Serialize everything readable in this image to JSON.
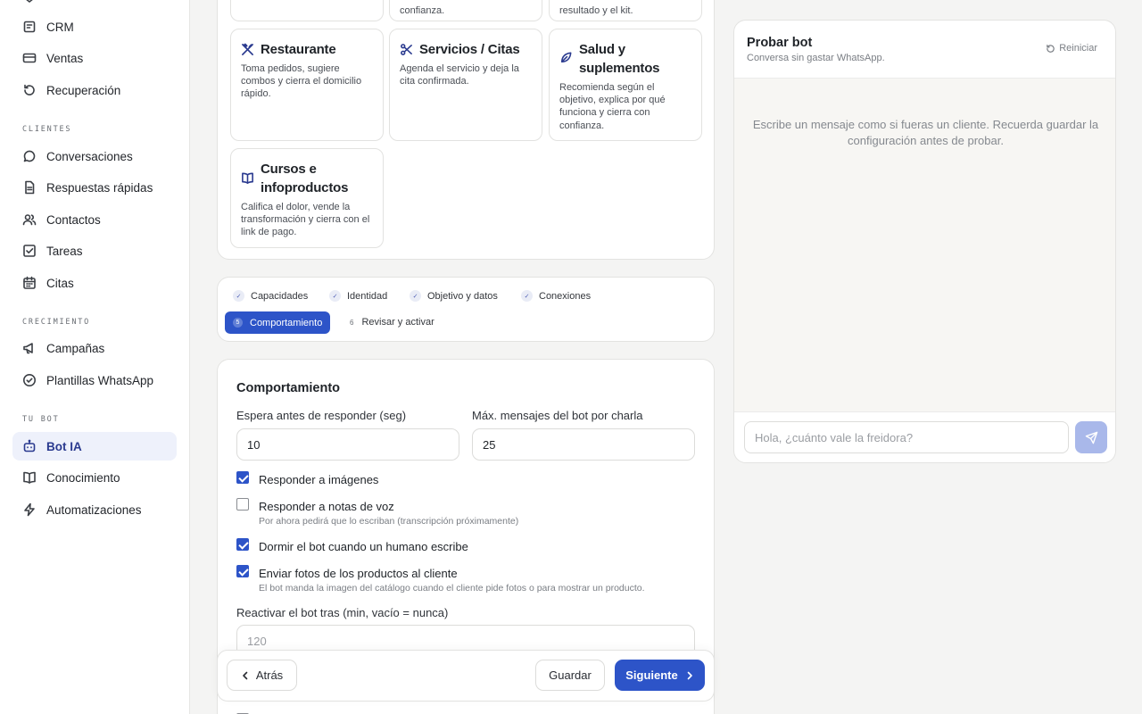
{
  "sidebar": {
    "items_top": [
      {
        "label": "CRM",
        "icon": "crm-icon"
      },
      {
        "label": "Ventas",
        "icon": "card-icon"
      },
      {
        "label": "Recuperación",
        "icon": "refresh-icon"
      }
    ],
    "sections": {
      "clientes": "CLIENTES",
      "crecimiento": "CRECIMIENTO",
      "tu_bot": "TU BOT"
    },
    "clientes_items": [
      {
        "label": "Conversaciones",
        "icon": "chat-icon"
      },
      {
        "label": "Respuestas rápidas",
        "icon": "document-icon"
      },
      {
        "label": "Contactos",
        "icon": "users-icon"
      },
      {
        "label": "Tareas",
        "icon": "checkbox-icon"
      },
      {
        "label": "Citas",
        "icon": "calendar-icon"
      }
    ],
    "crecimiento_items": [
      {
        "label": "Campañas",
        "icon": "megaphone-icon"
      },
      {
        "label": "Plantillas WhatsApp",
        "icon": "check-circle-icon"
      }
    ],
    "bot_items": [
      {
        "label": "Bot IA",
        "icon": "bot-icon"
      },
      {
        "label": "Conocimiento",
        "icon": "book-icon"
      },
      {
        "label": "Automatizaciones",
        "icon": "lightning-icon"
      }
    ]
  },
  "templates": {
    "cut_1": "confianza.",
    "cut_2": "resultado y el kit.",
    "items": [
      {
        "title": "Restaurante",
        "desc": "Toma pedidos, sugiere combos y cierra el domicilio rápido.",
        "icon": "utensils-icon"
      },
      {
        "title": "Servicios / Citas",
        "desc": "Agenda el servicio y deja la cita confirmada.",
        "icon": "scissors-icon"
      },
      {
        "title": "Salud y suplementos",
        "desc": "Recomienda según el objetivo, explica por qué funciona y cierra con confianza.",
        "icon": "leaf-icon"
      },
      {
        "title": "Cursos e infoproductos",
        "desc": "Califica el dolor, vende la transformación y cierra con el link de pago.",
        "icon": "book-open-icon"
      }
    ]
  },
  "steps": {
    "done": [
      "Capacidades",
      "Identidad",
      "Objetivo y datos",
      "Conexiones"
    ],
    "current_num": "5",
    "current_label": "Comportamiento",
    "next_num": "6",
    "next_label": "Revisar y activar"
  },
  "form": {
    "title": "Comportamiento",
    "wait_label": "Espera antes de responder (seg)",
    "wait_value": "10",
    "max_label": "Máx. mensajes del bot por charla",
    "max_value": "25",
    "checkboxes": [
      {
        "label": "Responder a imágenes",
        "checked": true,
        "hint": ""
      },
      {
        "label": "Responder a notas de voz",
        "checked": false,
        "hint": "Por ahora pedirá que lo escriban (transcripción próximamente)"
      },
      {
        "label": "Dormir el bot cuando un humano escribe",
        "checked": true,
        "hint": ""
      },
      {
        "label": "Enviar fotos de los productos al cliente",
        "checked": true,
        "hint": "El bot manda la imagen del catálogo cuando el cliente pide fotos o para mostrar un producto."
      }
    ],
    "reactivate_label": "Reactivar el bot tras (min, vacío = nunca)",
    "reactivate_placeholder": "120"
  },
  "footer": {
    "back": "Atrás",
    "save": "Guardar",
    "next": "Siguiente"
  },
  "test_bot": {
    "title": "Probar bot",
    "subtitle": "Conversa sin gastar WhatsApp.",
    "reset": "Reiniciar",
    "empty_message": "Escribe un mensaje como si fueras un cliente. Recuerda guardar la configuración antes de probar.",
    "input_placeholder": "Hola, ¿cuánto vale la freidora?"
  },
  "colors": {
    "accent": "#2d54c8",
    "active_nav_bg": "#eef1fb",
    "page_bg": "#f4f4f3"
  }
}
